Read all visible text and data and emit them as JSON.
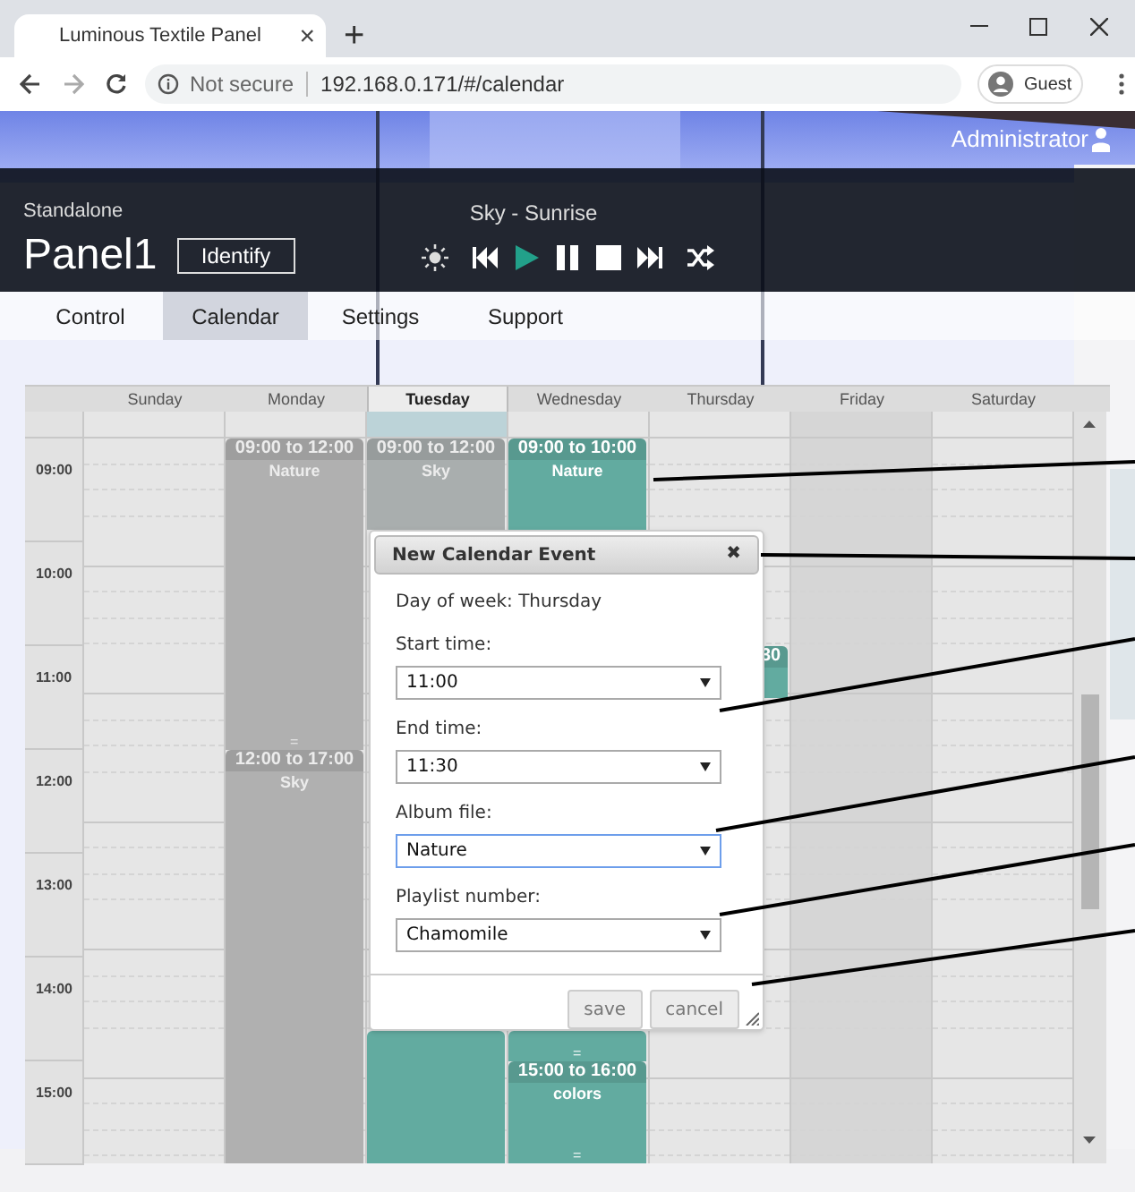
{
  "browser": {
    "tab_title": "Luminous Textile Panel",
    "tab_close": "×",
    "new_tab": "+",
    "security": "Not secure",
    "url": "192.168.0.171/#/calendar",
    "profile": "Guest"
  },
  "user": {
    "name": "Administrator"
  },
  "header": {
    "mode": "Standalone",
    "panel": "Panel1",
    "identify": "Identify",
    "now_playing": "Sky - Sunrise",
    "controls": [
      {
        "kind": "brightness",
        "active": false
      },
      {
        "kind": "previous",
        "active": false
      },
      {
        "kind": "play",
        "active": true
      },
      {
        "kind": "pause",
        "active": false
      },
      {
        "kind": "stop",
        "active": false
      },
      {
        "kind": "next",
        "active": false
      },
      {
        "kind": "shuffle",
        "active": false
      }
    ]
  },
  "nav_tabs": [
    {
      "label": "Control",
      "selected": false
    },
    {
      "label": "Calendar",
      "selected": true
    },
    {
      "label": "Settings",
      "selected": false
    },
    {
      "label": "Support",
      "selected": false
    }
  ],
  "calendar": {
    "times": [
      "09:00",
      "10:00",
      "11:00",
      "12:00",
      "13:00",
      "14:00",
      "15:00"
    ],
    "days": [
      {
        "label": "Sunday",
        "today": false,
        "shaded": false
      },
      {
        "label": "Monday",
        "today": false,
        "shaded": false,
        "events": [
          {
            "title": "09:00 to 12:00",
            "album": "Nature",
            "color": "#b0b0b0",
            "handle": "="
          },
          {
            "title": "12:00 to 17:00",
            "album": "Sky",
            "color": "#b0b0b0"
          }
        ]
      },
      {
        "label": "Tuesday",
        "today": true,
        "shaded": false,
        "events": [
          {
            "title": "09:00 to 12:00",
            "album": "Sky",
            "color": "#a9aeae"
          },
          {
            "color": "#62aba0"
          }
        ]
      },
      {
        "label": "Wednesday",
        "today": false,
        "shaded": false,
        "events": [
          {
            "title": "09:00 to 10:00",
            "album": "Nature",
            "color": "#62aba0"
          },
          {
            "color": "#62aba0",
            "handle": "="
          },
          {
            "title": "15:00 to 16:00",
            "album": "colors",
            "color": "#62aba0",
            "handle": "="
          }
        ]
      },
      {
        "label": "Thursday",
        "today": false,
        "shaded": false,
        "events": [
          {
            "title": "30",
            "color": "#62aba0"
          }
        ]
      },
      {
        "label": "Friday",
        "today": false,
        "shaded": true
      },
      {
        "label": "Saturday",
        "today": false,
        "shaded": false
      }
    ]
  },
  "dialog": {
    "title": "New Calendar Event",
    "close": "✖",
    "day_of_week": "Day of week: Thursday",
    "fields": [
      {
        "label": "Start time:",
        "value": "11:00",
        "focused": false
      },
      {
        "label": "End time:",
        "value": "11:30",
        "focused": false
      },
      {
        "label": "Album file:",
        "value": "Nature",
        "focused": true
      },
      {
        "label": "Playlist number:",
        "value": "Chamomile",
        "focused": false
      }
    ],
    "buttons": [
      {
        "label": "save"
      },
      {
        "label": "cancel"
      }
    ]
  }
}
